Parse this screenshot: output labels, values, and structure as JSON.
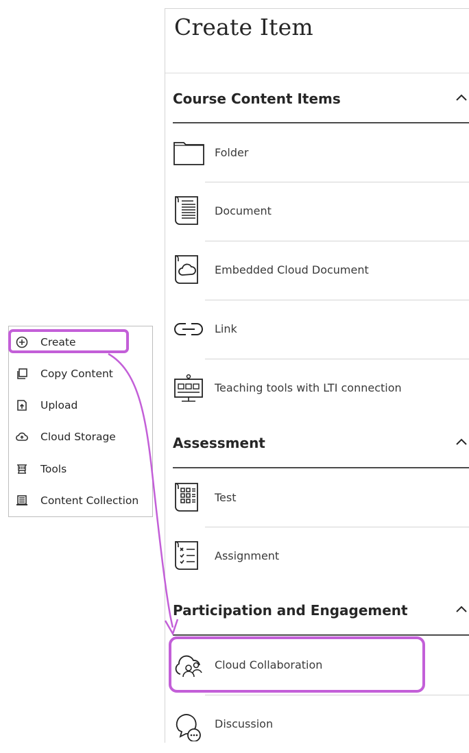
{
  "menu": {
    "items": [
      {
        "label": "Create",
        "icon": "plus-circle-icon"
      },
      {
        "label": "Copy Content",
        "icon": "copy-icon"
      },
      {
        "label": "Upload",
        "icon": "upload-icon"
      },
      {
        "label": "Cloud Storage",
        "icon": "cloud-upload-icon"
      },
      {
        "label": "Tools",
        "icon": "tools-cart-icon"
      },
      {
        "label": "Content Collection",
        "icon": "content-collection-icon"
      }
    ]
  },
  "panel": {
    "title": "Create Item",
    "sections": [
      {
        "title": "Course Content Items",
        "items": [
          {
            "label": "Folder",
            "icon": "folder-icon"
          },
          {
            "label": "Document",
            "icon": "document-icon"
          },
          {
            "label": "Embedded Cloud Document",
            "icon": "cloud-document-icon"
          },
          {
            "label": "Link",
            "icon": "link-icon"
          },
          {
            "label": "Teaching tools with LTI connection",
            "icon": "lti-tool-icon"
          }
        ]
      },
      {
        "title": "Assessment",
        "items": [
          {
            "label": "Test",
            "icon": "test-icon"
          },
          {
            "label": "Assignment",
            "icon": "assignment-icon"
          }
        ]
      },
      {
        "title": "Participation and Engagement",
        "items": [
          {
            "label": "Cloud Collaboration",
            "icon": "cloud-collaboration-icon"
          },
          {
            "label": "Discussion",
            "icon": "discussion-icon"
          }
        ]
      }
    ]
  },
  "colors": {
    "highlight": "#c35fd8",
    "text": "#262626",
    "rule": "#4a4a4a"
  }
}
